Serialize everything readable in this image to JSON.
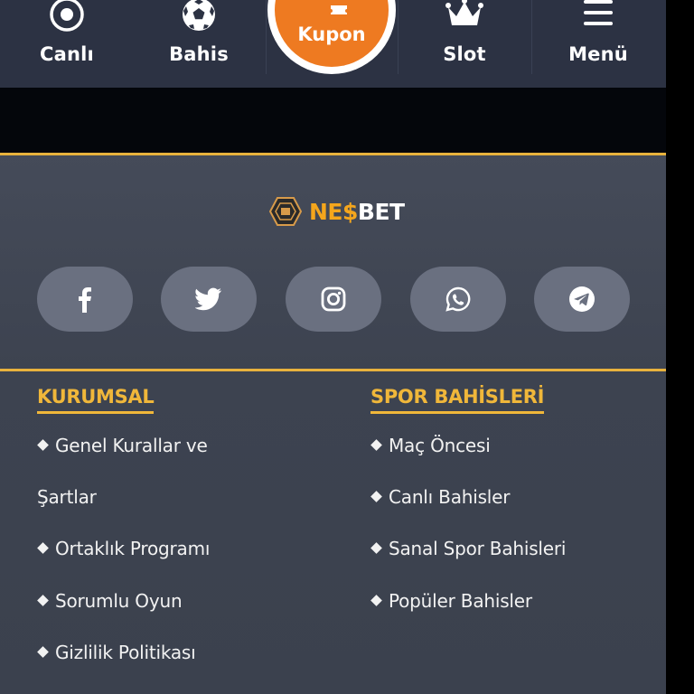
{
  "nav": {
    "items": [
      {
        "label": "Canlı",
        "icon": "live-icon"
      },
      {
        "label": "Bahis",
        "icon": "soccer-ball-icon"
      },
      {
        "label": "Kupon",
        "icon": "ticket-icon"
      },
      {
        "label": "Slot",
        "icon": "crown-icon"
      },
      {
        "label": "Menü",
        "icon": "hamburger-menu-icon"
      }
    ],
    "accent": "#ee7a21",
    "background": "#2c3243"
  },
  "footer": {
    "logo": {
      "part1": "NE$",
      "part2": "BET"
    },
    "social": [
      {
        "name": "facebook",
        "icon": "facebook-icon"
      },
      {
        "name": "twitter",
        "icon": "twitter-icon"
      },
      {
        "name": "instagram",
        "icon": "instagram-icon"
      },
      {
        "name": "whatsapp",
        "icon": "whatsapp-icon"
      },
      {
        "name": "telegram",
        "icon": "telegram-icon"
      }
    ],
    "columns": [
      {
        "title": "KURUMSAL",
        "links": [
          "Genel Kurallar ve",
          "Şartlar",
          "Ortaklık Programı",
          "Sorumlu Oyun",
          "Gizlilik Politikası"
        ]
      },
      {
        "title": "SPOR BAHİSLERİ",
        "links": [
          "Maç Öncesi",
          "Canlı Bahisler",
          "Sanal Spor Bahisleri",
          "Popüler Bahisler"
        ]
      }
    ],
    "gold": "#f0b73a",
    "background": "#3d4350"
  }
}
